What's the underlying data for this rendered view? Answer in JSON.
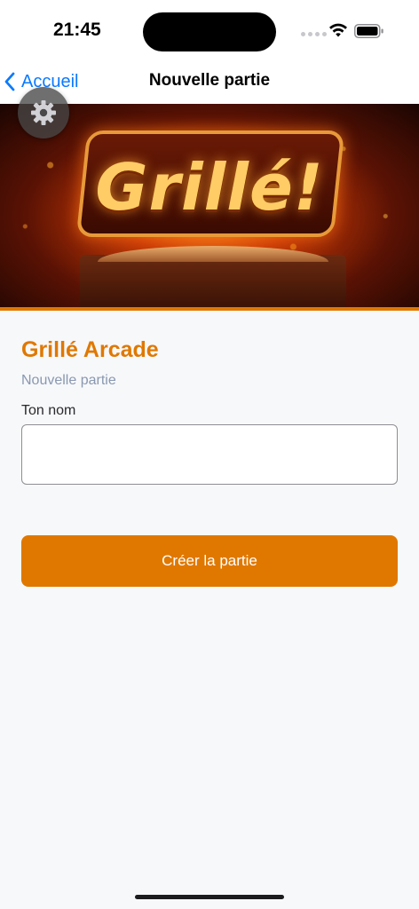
{
  "status_bar": {
    "time": "21:45"
  },
  "nav": {
    "back_label": "Accueil",
    "title": "Nouvelle partie"
  },
  "hero": {
    "logo_text": "Grillé!"
  },
  "form": {
    "app_title": "Grillé Arcade",
    "subtitle": "Nouvelle partie",
    "name_label": "Ton nom",
    "name_value": "",
    "name_placeholder": "",
    "submit_label": "Créer la partie"
  },
  "colors": {
    "accent": "#e07800",
    "link": "#0a7aff",
    "subtitle": "#8a98b0",
    "background": "#f7f8fa"
  },
  "icons": {
    "back": "chevron-left-icon",
    "settings": "gear-icon",
    "wifi": "wifi-icon",
    "battery": "battery-icon"
  }
}
